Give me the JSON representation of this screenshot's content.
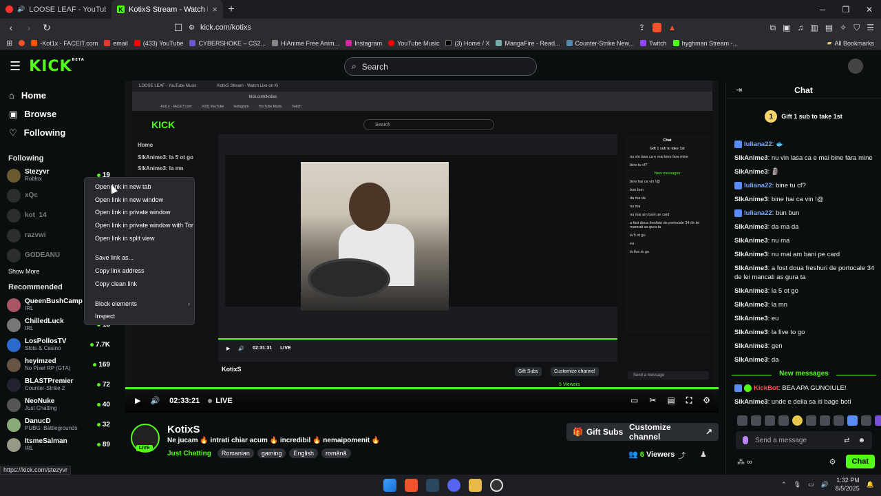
{
  "tabs": [
    {
      "title": "LOOSE LEAF - YouTube Music",
      "active": false
    },
    {
      "title": "KotixS Stream - Watch Live on Ki",
      "active": true
    }
  ],
  "url": "kick.com/kotixs",
  "bookmarks": [
    {
      "label": "-Kot1x - FACEIT.com",
      "color": "#f50"
    },
    {
      "label": "email",
      "color": "#e33"
    },
    {
      "label": "(433) YouTube",
      "color": "#f00"
    },
    {
      "label": "CYBERSHOKE – CS2...",
      "color": "#6a5acd"
    },
    {
      "label": "HiAnime Free Anim...",
      "color": "#888"
    },
    {
      "label": "Instagram",
      "color": "#d6249f"
    },
    {
      "label": "YouTube Music",
      "color": "#f00"
    },
    {
      "label": "(3) Home / X",
      "color": "#000"
    },
    {
      "label": "MangaFire - Read...",
      "color": "#7aa"
    },
    {
      "label": "Counter-Strike New...",
      "color": "#58a"
    },
    {
      "label": "Twitch",
      "color": "#9146ff"
    },
    {
      "label": "hyghman Stream -...",
      "color": "#53fc18"
    }
  ],
  "all_bookmarks": "All Bookmarks",
  "site": {
    "logo": "KICK",
    "logo_sup": "BETA",
    "search_placeholder": "Search"
  },
  "nav": {
    "home": "Home",
    "browse": "Browse",
    "following": "Following"
  },
  "following_label": "Following",
  "following": [
    {
      "name": "Stezyvr",
      "game": "Roblox",
      "count": "19",
      "dim": false
    },
    {
      "name": "xQc",
      "game": "",
      "count": "",
      "dim": true
    },
    {
      "name": "kot_14",
      "game": "",
      "count": "",
      "dim": true
    },
    {
      "name": "razvwi",
      "game": "",
      "count": "",
      "dim": true
    },
    {
      "name": "GODEANU",
      "game": "",
      "count": "",
      "dim": true
    }
  ],
  "show_more": "Show More",
  "recommended_label": "Recommended",
  "recommended": [
    {
      "name": "QueenBushCamp",
      "game": "IRL",
      "count": ""
    },
    {
      "name": "ChilledLuck",
      "game": "IRL",
      "count": "13"
    },
    {
      "name": "LosPollosTV",
      "game": "Slots & Casino",
      "count": "7.7K"
    },
    {
      "name": "heyimzed",
      "game": "No Pixel RP (GTA)",
      "count": "169"
    },
    {
      "name": "BLASTPremier",
      "game": "Counter-Strike 2",
      "count": "72"
    },
    {
      "name": "NeoNuke",
      "game": "Just Chatting",
      "count": "40"
    },
    {
      "name": "DanucD",
      "game": "PUBG: Battlegrounds",
      "count": "32"
    },
    {
      "name": "ItsmeSalman",
      "game": "IRL",
      "count": "89"
    }
  ],
  "context_menu": [
    {
      "label": "Open link in new tab",
      "sep": false,
      "arrow": false
    },
    {
      "label": "Open link in new window",
      "sep": false,
      "arrow": false
    },
    {
      "label": "Open link in private window",
      "sep": false,
      "arrow": false
    },
    {
      "label": "Open link in private window with Tor",
      "sep": false,
      "arrow": false
    },
    {
      "label": "Open link in split view",
      "sep": false,
      "arrow": false
    },
    {
      "label": "Save link as...",
      "sep": true,
      "arrow": false
    },
    {
      "label": "Copy link address",
      "sep": false,
      "arrow": false
    },
    {
      "label": "Copy clean link",
      "sep": false,
      "arrow": false
    },
    {
      "label": "Block elements",
      "sep": true,
      "arrow": true
    },
    {
      "label": "Inspect",
      "sep": false,
      "arrow": false
    }
  ],
  "player": {
    "time": "02:33:21",
    "live": "LIVE",
    "inner": {
      "search": "Search",
      "home": "Home",
      "side_lines": [
        "SlkAnime3: la 5 ot go",
        "SlkAnime3: la mn"
      ],
      "chat_title": "Chat",
      "gift": "Gift 1 sub to take 1st",
      "new_messages": "New messages",
      "time": "02:31:31",
      "live": "LIVE",
      "name": "KotixS",
      "gift_subs": "Gift Subs",
      "customize": "Customize channel",
      "viewers": "5 Viewers",
      "send": "Send a message"
    }
  },
  "stream": {
    "name": "KotixS",
    "live": "LIVE",
    "title": "Ne jucam 🔥 intrati chiar acum 🔥 incredibil 🔥 nemaipomenit 🔥",
    "category": "Just Chatting",
    "tags": [
      "Romanian",
      "gaming",
      "English",
      "română"
    ],
    "gift_subs": "Gift Subs",
    "customize": "Customize channel",
    "viewers_num": "6",
    "viewers_label": "Viewers"
  },
  "chat": {
    "title": "Chat",
    "gift": "Gift 1 sub to take 1st",
    "messages": [
      {
        "user": "Iuliana22",
        "text": "",
        "color": "#7aa7ff",
        "badge": true
      },
      {
        "user": "SlkAnime3",
        "text": "nu vin lasa ca e mai bine fara mine",
        "color": "#e6e6e6",
        "badge": false
      },
      {
        "user": "SlkAnime3",
        "text": "",
        "color": "#e6e6e6",
        "badge": false
      },
      {
        "user": "Iuliana22",
        "text": "bine tu cf?",
        "color": "#7aa7ff",
        "badge": true
      },
      {
        "user": "SlkAnime3",
        "text": "bine hai ca vin !@",
        "color": "#e6e6e6",
        "badge": false
      },
      {
        "user": "Iuliana22",
        "text": "bun bun",
        "color": "#7aa7ff",
        "badge": true
      },
      {
        "user": "SlkAnime3",
        "text": "da ma da",
        "color": "#e6e6e6",
        "badge": false
      },
      {
        "user": "SlkAnime3",
        "text": "nu ma",
        "color": "#e6e6e6",
        "badge": false
      },
      {
        "user": "SlkAnime3",
        "text": "nu mai am bani pe card",
        "color": "#e6e6e6",
        "badge": false
      },
      {
        "user": "SlkAnime3",
        "text": "a fost doua freshuri de portocale 34 de lei mancati as gura ta",
        "color": "#e6e6e6",
        "badge": false
      },
      {
        "user": "SlkAnime3",
        "text": "la 5 ot go",
        "color": "#e6e6e6",
        "badge": false
      },
      {
        "user": "SlkAnime3",
        "text": "la mn",
        "color": "#e6e6e6",
        "badge": false
      },
      {
        "user": "SlkAnime3",
        "text": "eu",
        "color": "#e6e6e6",
        "badge": false
      },
      {
        "user": "SlkAnime3",
        "text": "la five to go",
        "color": "#e6e6e6",
        "badge": false
      },
      {
        "user": "SlkAnime3",
        "text": "gen",
        "color": "#e6e6e6",
        "badge": false
      },
      {
        "user": "SlkAnime3",
        "text": "da",
        "color": "#e6e6e6",
        "badge": false
      }
    ],
    "new_messages": "New messages",
    "new": [
      {
        "user": "KickBot",
        "text": "BEA APA GUNOIULE!",
        "color": "#ff4f4f",
        "badge": true
      },
      {
        "user": "SlkAnime3",
        "text": "unde e delia sa iti bage boti",
        "color": "#e6e6e6",
        "badge": false
      }
    ],
    "send_placeholder": "Send a message",
    "chat_button": "Chat"
  },
  "status_url": "https://kick.com/stezyvr",
  "clock": {
    "time": "1:32 PM",
    "date": "8/5/2025"
  }
}
